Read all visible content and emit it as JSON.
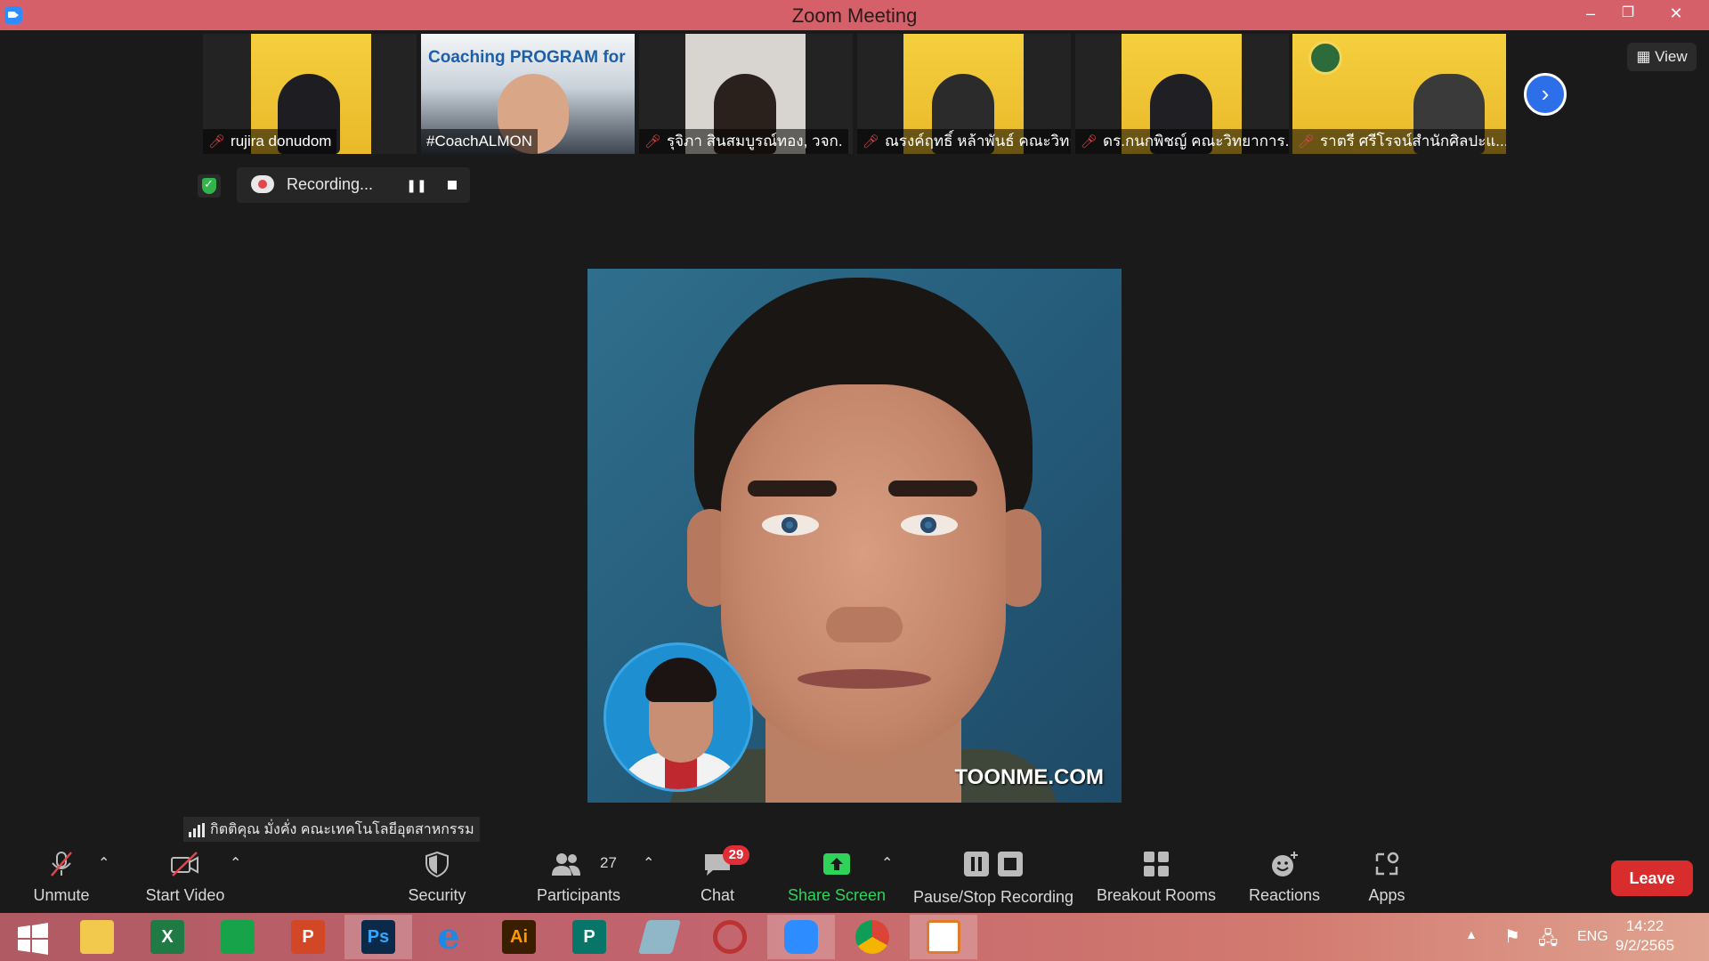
{
  "window": {
    "title": "Zoom Meeting",
    "minimize": "–",
    "restore": "❐",
    "close": "✕"
  },
  "participants_strip": [
    {
      "name": "rujira donudom",
      "muted": true
    },
    {
      "name": "#CoachALMON",
      "muted": false,
      "slide_text": "Coaching PROGRAM for"
    },
    {
      "name": "รุจิภา สินสมบูรณ์ทอง, วจก.",
      "muted": true
    },
    {
      "name": "ณรงค์ฤทธิ์ หล้าพันธ์ คณะวิทย์",
      "muted": true
    },
    {
      "name": "ดร.กนกพิชญ์ คณะวิทยาการ...",
      "muted": true
    },
    {
      "name": "ราตรี ศรีโรจน์สำนักศิลปะแ...",
      "muted": true
    }
  ],
  "strip_next_icon": "chevron-right-icon",
  "view_button": {
    "label": "View"
  },
  "recording": {
    "label": "Recording...",
    "pause_glyph": "❚❚"
  },
  "main_video": {
    "watermark": "TOONME.COM"
  },
  "speaking": {
    "name": "กิตติคุณ มั่งคั่ง คณะเทคโนโลยีอุตสาหกรรม"
  },
  "toolbar": {
    "unmute": "Unmute",
    "start_video": "Start Video",
    "security": "Security",
    "participants": "Participants",
    "participants_count": "27",
    "chat": "Chat",
    "chat_badge": "29",
    "share_screen": "Share Screen",
    "pause_stop_recording": "Pause/Stop Recording",
    "breakout_rooms": "Breakout Rooms",
    "reactions": "Reactions",
    "apps": "Apps",
    "leave": "Leave",
    "caret": "⌃"
  },
  "taskbar": {
    "apps": [
      {
        "name": "windows-start",
        "glyph": "",
        "color": "#3aa0e8"
      },
      {
        "name": "file-explorer",
        "glyph": "",
        "color": "#f2c94c"
      },
      {
        "name": "excel",
        "glyph": "X",
        "color": "#1f7a44"
      },
      {
        "name": "store",
        "glyph": "",
        "color": "#16a34a"
      },
      {
        "name": "powerpoint",
        "glyph": "P",
        "color": "#d24726"
      },
      {
        "name": "photoshop",
        "glyph": "Ps",
        "color": "#0b2a4a"
      },
      {
        "name": "internet-explorer",
        "glyph": "e",
        "color": "#1e88e5"
      },
      {
        "name": "illustrator",
        "glyph": "Ai",
        "color": "#3a1e00"
      },
      {
        "name": "publisher",
        "glyph": "P",
        "color": "#077568"
      },
      {
        "name": "pen-tool",
        "glyph": "",
        "color": "#8fb7c8"
      },
      {
        "name": "photoscape",
        "glyph": "",
        "color": "#9b2b2b"
      },
      {
        "name": "zoom",
        "glyph": "",
        "color": "#2d8cff"
      },
      {
        "name": "chrome",
        "glyph": "",
        "color": "#e9a43a"
      },
      {
        "name": "paint",
        "glyph": "",
        "color": "#ffffff"
      }
    ],
    "active_app_index": 11,
    "language": "ENG",
    "time": "14:22",
    "date": "9/2/2565"
  },
  "colors": {
    "titlebar": "#d6606a",
    "accent_blue": "#2d6fe8",
    "leave_red": "#d92d2d",
    "share_green": "#2fd35a",
    "badge_red": "#e02e36"
  }
}
